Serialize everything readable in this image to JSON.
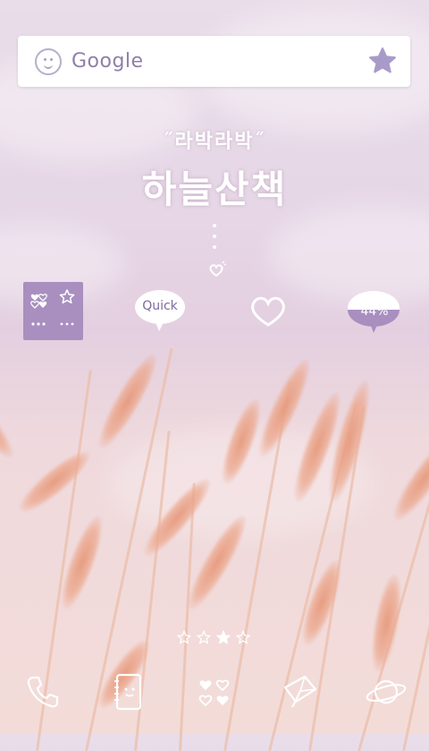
{
  "search": {
    "label": "Google"
  },
  "theme": {
    "title_small": "˝라박라박˝",
    "title_big": "하늘산책"
  },
  "widgets": {
    "quick_label": "Quick",
    "battery_label": "44%"
  },
  "page_indicator": {
    "pages": 4,
    "current": 3
  },
  "dock": [
    "phone-icon",
    "contacts-icon",
    "apps-icon",
    "browser-icon",
    "planet-icon"
  ],
  "colors": {
    "accent": "#a88fbf",
    "search_text": "#8f7fa8",
    "icon_stroke": "#ffffff"
  }
}
